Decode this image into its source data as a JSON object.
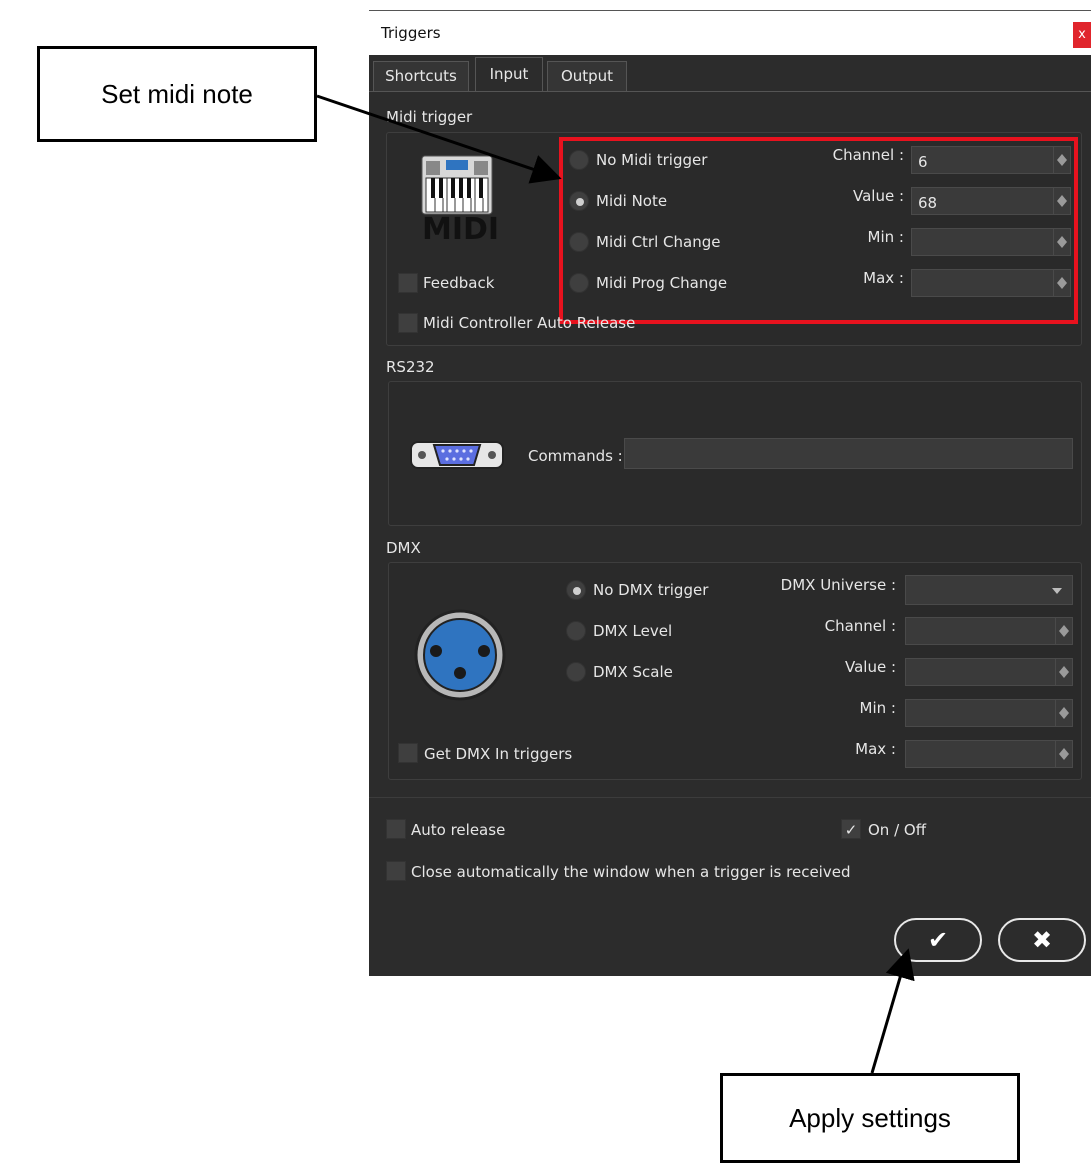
{
  "window": {
    "title": "Triggers",
    "close_glyph": "x"
  },
  "tabs": [
    {
      "label": "Shortcuts",
      "active": false
    },
    {
      "label": "Input",
      "active": true
    },
    {
      "label": "Output",
      "active": false
    }
  ],
  "midi": {
    "section_title": "Midi trigger",
    "logo_text": "MIDI",
    "radios": [
      {
        "label": "No Midi trigger",
        "checked": false
      },
      {
        "label": "Midi Note",
        "checked": true
      },
      {
        "label": "Midi Ctrl Change",
        "checked": false
      },
      {
        "label": "Midi Prog Change",
        "checked": false
      }
    ],
    "fields": [
      {
        "label": "Channel :",
        "value": "6"
      },
      {
        "label": "Value :",
        "value": "68"
      },
      {
        "label": "Min :",
        "value": ""
      },
      {
        "label": "Max :",
        "value": ""
      }
    ],
    "feedback_label": "Feedback",
    "auto_release_label": "Midi Controller Auto Release"
  },
  "rs232": {
    "section_title": "RS232",
    "commands_label": "Commands :",
    "commands_value": ""
  },
  "dmx": {
    "section_title": "DMX",
    "radios": [
      {
        "label": "No DMX trigger",
        "checked": true
      },
      {
        "label": "DMX Level",
        "checked": false
      },
      {
        "label": "DMX Scale",
        "checked": false
      }
    ],
    "universe_label": "DMX Universe :",
    "universe_value": "",
    "fields": [
      {
        "label": "Channel :",
        "value": ""
      },
      {
        "label": "Value :",
        "value": ""
      },
      {
        "label": "Min :",
        "value": ""
      },
      {
        "label": "Max :",
        "value": ""
      }
    ],
    "get_in_label": "Get DMX In triggers"
  },
  "footer": {
    "auto_release_label": "Auto release",
    "on_off_label": "On / Off",
    "on_off_checked": true,
    "close_auto_label": "Close automatically the window when a trigger is received"
  },
  "buttons": {
    "ok_glyph": "✔",
    "cancel_glyph": "✖"
  },
  "annotations": {
    "set_midi_note": "Set midi note",
    "apply_settings": "Apply settings"
  },
  "colors": {
    "highlight": "#e8121e",
    "dialog_bg": "#2c2c2c"
  }
}
